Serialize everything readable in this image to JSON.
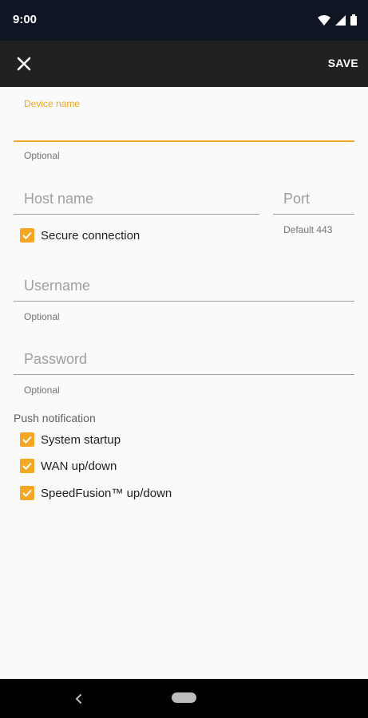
{
  "status_bar": {
    "time": "9:00",
    "icons": [
      "wifi-icon",
      "cell-signal-icon",
      "battery-icon"
    ]
  },
  "toolbar": {
    "close_icon": "close-icon",
    "save_label": "SAVE"
  },
  "form": {
    "device_name": {
      "label": "Device name",
      "value": "",
      "hint": "Optional"
    },
    "host_name": {
      "placeholder": "Host name",
      "value": ""
    },
    "port": {
      "placeholder": "Port",
      "value": "",
      "hint": "Default 443"
    },
    "secure_connection": {
      "label": "Secure connection",
      "checked": true
    },
    "username": {
      "placeholder": "Username",
      "value": "",
      "hint": "Optional"
    },
    "password": {
      "placeholder": "Password",
      "value": "",
      "hint": "Optional"
    }
  },
  "push_notification": {
    "title": "Push notification",
    "items": [
      {
        "label": "System startup",
        "checked": true
      },
      {
        "label": "WAN up/down",
        "checked": true
      },
      {
        "label": "SpeedFusion™ up/down",
        "checked": true
      }
    ]
  },
  "colors": {
    "accent": "#f5a623",
    "status_bar": "#0e1624",
    "toolbar": "#212121",
    "background": "#fafafa"
  },
  "nav_bar": {
    "back_icon": "back-icon",
    "home_icon": "home-pill-icon"
  }
}
